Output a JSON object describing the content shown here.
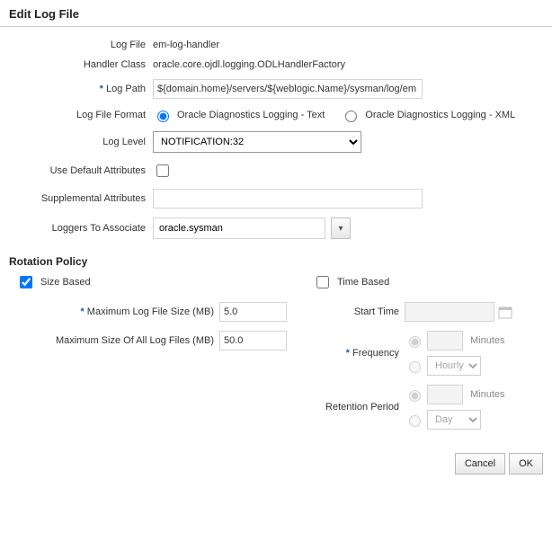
{
  "dialog": {
    "title": "Edit Log File"
  },
  "fields": {
    "log_file": {
      "label": "Log File",
      "value": "em-log-handler"
    },
    "handler_class": {
      "label": "Handler Class",
      "value": "oracle.core.ojdl.logging.ODLHandlerFactory"
    },
    "log_path": {
      "label": "Log Path",
      "value": "${domain.home}/servers/${weblogic.Name}/sysman/log/em"
    },
    "log_file_format": {
      "label": "Log File Format",
      "option_text": "Oracle Diagnostics Logging - Text",
      "option_xml": "Oracle Diagnostics Logging - XML"
    },
    "log_level": {
      "label": "Log Level",
      "value": "NOTIFICATION:32"
    },
    "use_default_attributes": {
      "label": "Use Default Attributes"
    },
    "supplemental_attributes": {
      "label": "Supplemental Attributes",
      "value": ""
    },
    "loggers_to_associate": {
      "label": "Loggers To Associate",
      "value": "oracle.sysman"
    }
  },
  "rotation": {
    "section_title": "Rotation Policy",
    "size_based": {
      "label": "Size Based",
      "max_log_file_size": {
        "label": "Maximum Log File Size (MB)",
        "value": "5.0"
      },
      "max_all_log_files": {
        "label": "Maximum Size Of All Log Files (MB)",
        "value": "50.0"
      }
    },
    "time_based": {
      "label": "Time Based",
      "start_time": {
        "label": "Start Time",
        "value": ""
      },
      "frequency": {
        "label": "Frequency",
        "minutes_unit": "Minutes",
        "hourly_option": "Hourly"
      },
      "retention": {
        "label": "Retention Period",
        "minutes_unit": "Minutes",
        "day_option": "Day"
      }
    }
  },
  "buttons": {
    "cancel": "Cancel",
    "ok": "OK"
  }
}
